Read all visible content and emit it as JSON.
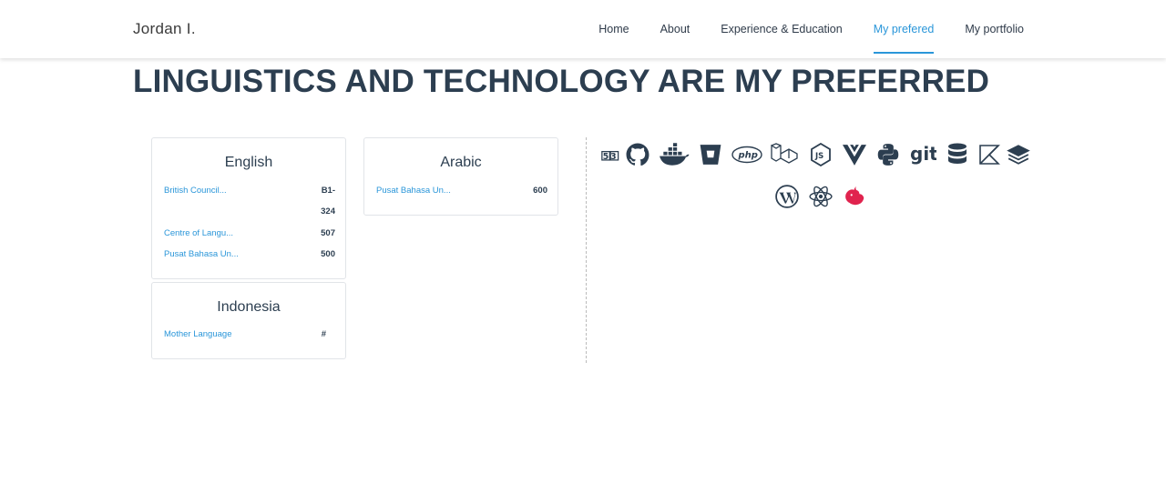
{
  "brand": "Jordan I.",
  "nav": [
    {
      "label": "Home",
      "active": false
    },
    {
      "label": "About",
      "active": false
    },
    {
      "label": "Experience & Education",
      "active": false
    },
    {
      "label": "My prefered",
      "active": true
    },
    {
      "label": "My portfolio",
      "active": false
    }
  ],
  "title": "LINGUISTICS AND TECHNOLOGY ARE MY PREFERRED",
  "languages": {
    "english": {
      "name": "English",
      "rows": [
        {
          "name": "British Council...",
          "score": "B1-"
        },
        {
          "name": "",
          "score": "324"
        },
        {
          "name": "Centre of Langu...",
          "score": "507"
        },
        {
          "name": "Pusat Bahasa Un...",
          "score": "500"
        }
      ]
    },
    "indonesia": {
      "name": "Indonesia",
      "rows": [
        {
          "name": "Mother Language",
          "score": "#"
        }
      ]
    },
    "arabic": {
      "name": "Arabic",
      "rows": [
        {
          "name": "Pusat Bahasa Un...",
          "score": "600"
        }
      ]
    }
  },
  "tech_icons": {
    "git_text": "git",
    "php_text": "php",
    "row1": [
      "html-css-icon",
      "github-icon",
      "docker-icon",
      "bitbucket-icon",
      "php-icon",
      "laravel-icon",
      "nodejs-icon",
      "vue-icon",
      "python-icon",
      "git-icon",
      "database-icon",
      "kotlin-icon",
      "layers-icon"
    ],
    "row2": [
      "wordpress-icon",
      "react-icon",
      "nestjs-icon"
    ]
  },
  "colors": {
    "accent": "#2a96d9",
    "heading": "#2c3e50",
    "nest": "#e0234e"
  }
}
